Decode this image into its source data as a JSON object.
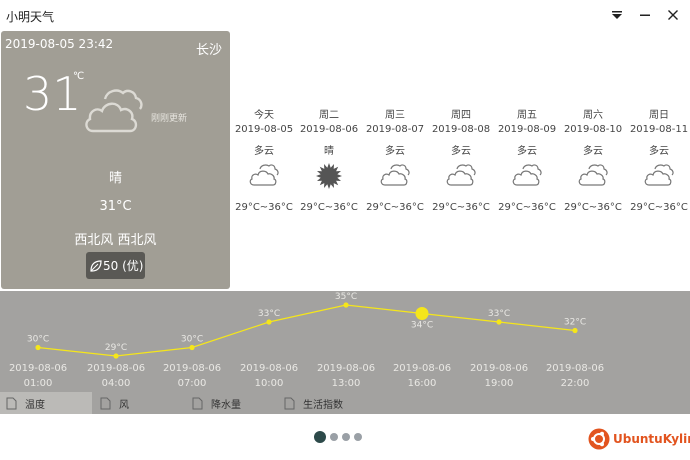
{
  "window": {
    "title": "小明天气"
  },
  "current": {
    "datetime": "2019-08-05 23:42",
    "city": "长沙",
    "temperature": "31",
    "unit": "°C",
    "updated_text": "刚刚更新",
    "condition": "晴",
    "temp_range": "31°C",
    "wind": "西北风 西北风",
    "aqi_text": "50 (优)",
    "icon": "cloudy-icon"
  },
  "forecast": [
    {
      "day": "今天",
      "date": "2019-08-05",
      "cond": "多云",
      "icon": "cloudy-icon",
      "range": "29°C~36°C"
    },
    {
      "day": "周二",
      "date": "2019-08-06",
      "cond": "晴",
      "icon": "sun-icon",
      "range": "29°C~36°C"
    },
    {
      "day": "周三",
      "date": "2019-08-07",
      "cond": "多云",
      "icon": "cloudy-icon",
      "range": "29°C~36°C"
    },
    {
      "day": "周四",
      "date": "2019-08-08",
      "cond": "多云",
      "icon": "cloudy-icon",
      "range": "29°C~36°C"
    },
    {
      "day": "周五",
      "date": "2019-08-09",
      "cond": "多云",
      "icon": "cloudy-icon",
      "range": "29°C~36°C"
    },
    {
      "day": "周六",
      "date": "2019-08-10",
      "cond": "多云",
      "icon": "cloudy-icon",
      "range": "29°C~36°C"
    },
    {
      "day": "周日",
      "date": "2019-08-11",
      "cond": "多云",
      "icon": "cloudy-icon",
      "range": "29°C~36°C"
    }
  ],
  "hourly": {
    "temps": [
      30,
      29,
      30,
      33,
      35,
      34,
      33,
      32
    ],
    "temp_labels": [
      "30°C",
      "29°C",
      "30°C",
      "33°C",
      "35°C",
      "34°C",
      "33°C",
      "32°C"
    ],
    "dates": [
      "2019-08-06",
      "2019-08-06",
      "2019-08-06",
      "2019-08-06",
      "2019-08-06",
      "2019-08-06",
      "2019-08-06",
      "2019-08-06"
    ],
    "times": [
      "01:00",
      "04:00",
      "07:00",
      "10:00",
      "13:00",
      "16:00",
      "19:00",
      "22:00"
    ],
    "highlight_index": 5,
    "line_color": "#f5e61a"
  },
  "tabs": [
    {
      "label": "温度",
      "active": true
    },
    {
      "label": "风",
      "active": false
    },
    {
      "label": "降水量",
      "active": false
    },
    {
      "label": "生活指数",
      "active": false
    }
  ],
  "pager": {
    "count": 4,
    "active": 0
  },
  "logo": {
    "text": "UbuntuKylin",
    "color": "#e2541f"
  }
}
